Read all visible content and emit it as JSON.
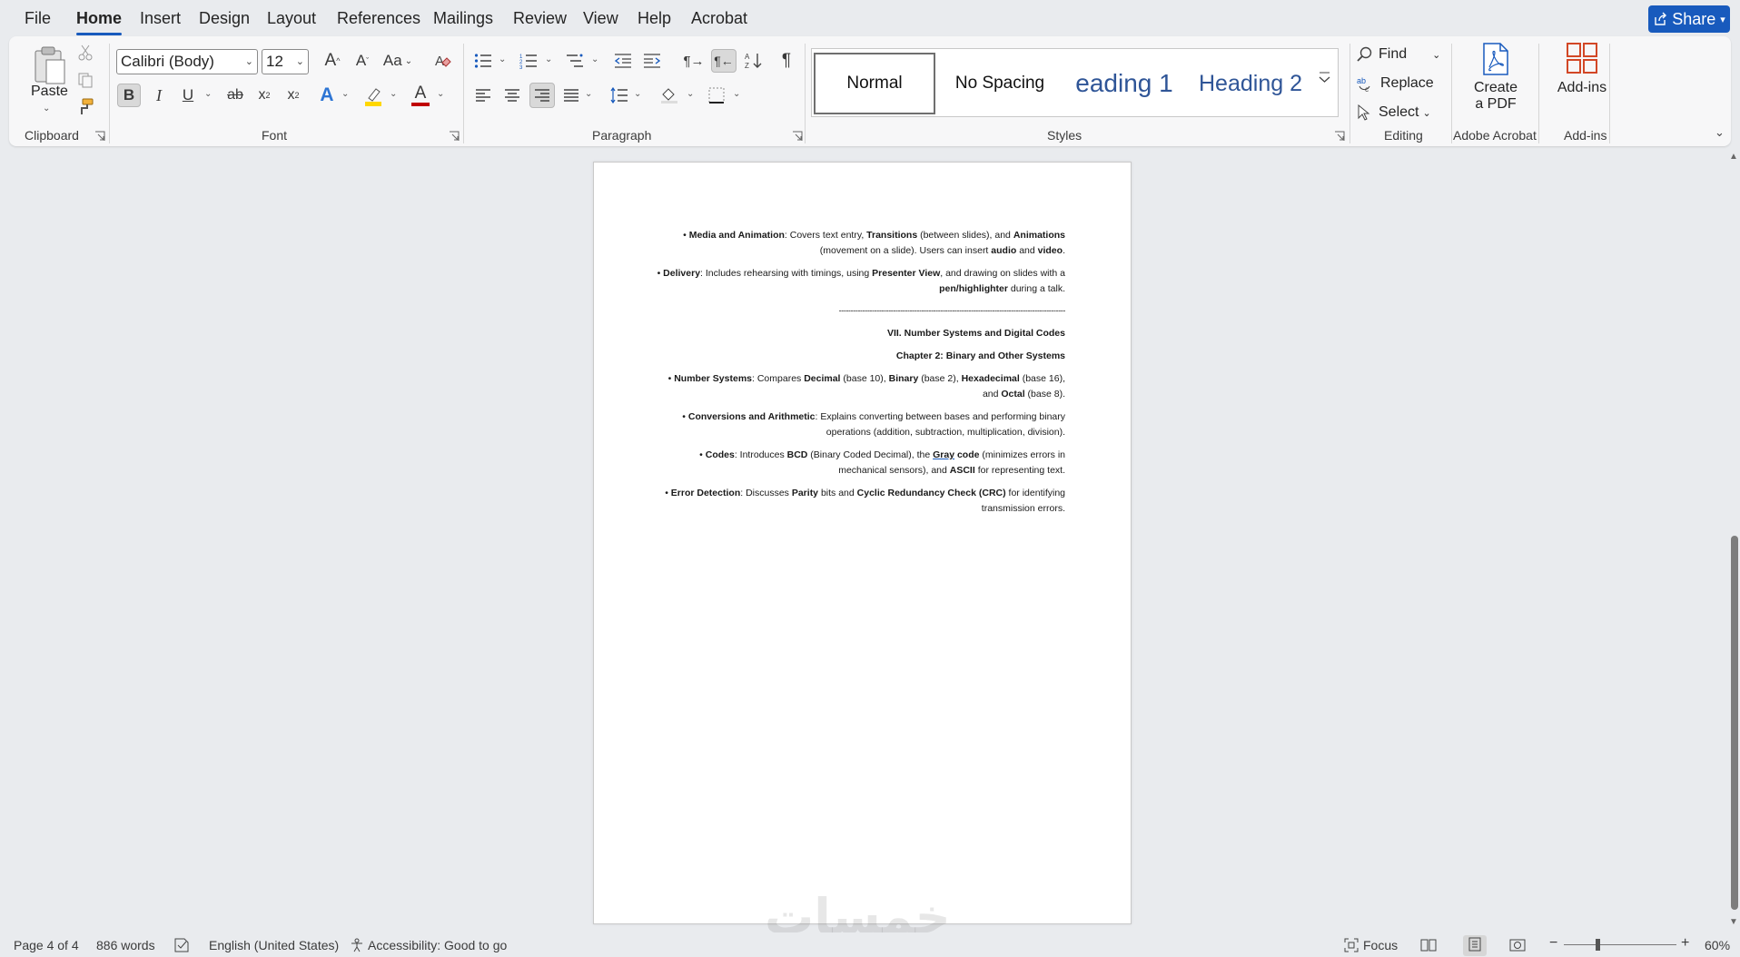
{
  "menu": {
    "tabs": [
      "File",
      "Home",
      "Insert",
      "Design",
      "Layout",
      "References",
      "Mailings",
      "Review",
      "View",
      "Help",
      "Acrobat"
    ],
    "active_tab": "Home",
    "share_label": "Share"
  },
  "ribbon": {
    "clipboard": {
      "paste_label": "Paste",
      "group_label": "Clipboard"
    },
    "font": {
      "font_name": "Calibri (Body)",
      "font_size": "12",
      "group_label": "Font",
      "change_case": "Aa"
    },
    "paragraph": {
      "group_label": "Paragraph"
    },
    "styles": {
      "group_label": "Styles",
      "items": [
        "Normal",
        "No Spacing",
        "eading 1",
        "Heading 2"
      ],
      "selected": "Normal"
    },
    "editing": {
      "find_label": "Find",
      "replace_label": "Replace",
      "select_label": "Select",
      "group_label": "Editing"
    },
    "acrobat": {
      "create_pdf_label_1": "Create",
      "create_pdf_label_2": "a PDF",
      "group_label": "Adobe Acrobat"
    },
    "addins": {
      "label": "Add-ins",
      "group_label": "Add-ins"
    }
  },
  "document": {
    "p1": {
      "bullet": "•",
      "b1": "Media and Animation",
      "t1": ": Covers text entry, ",
      "b2": "Transitions",
      "t2": " (between slides), and ",
      "b3": "Animations",
      "t3": " (movement on a slide). Users can insert ",
      "b4": "audio",
      "t4": " and ",
      "b5": "video",
      "t5": "."
    },
    "p2": {
      "bullet": "•",
      "b1": "Delivery",
      "t1": ": Includes rehearsing with timings, using ",
      "b2": "Presenter View",
      "t2": ", and drawing on slides with a ",
      "b3": "pen/highlighter",
      "t3": " during a talk."
    },
    "divider": "------------------------------------------------------------------------------------------------",
    "heading1": "VII. Number Systems and Digital Codes",
    "heading2": "Chapter 2: Binary and Other Systems",
    "p3": {
      "bullet": "•",
      "b1": "Number Systems",
      "t1": ": Compares ",
      "b2": "Decimal",
      "t2": " (base 10), ",
      "b3": "Binary",
      "t3": " (base 2), ",
      "b4": "Hexadecimal",
      "t4": " (base 16), and ",
      "b5": "Octal",
      "t5": " (base 8)."
    },
    "p4": {
      "bullet": "•",
      "b1": "Conversions and Arithmetic",
      "t1": ": Explains converting between bases and performing binary operations (addition, subtraction, multiplication, division)."
    },
    "p5": {
      "bullet": "•",
      "b1": "Codes",
      "t1": ": Introduces ",
      "b2": "BCD",
      "t2": " (Binary Coded Decimal), the ",
      "b3": "Gray",
      "b3b": " code",
      "t3": " (minimizes errors in mechanical sensors), and ",
      "b4": "ASCII",
      "t4": " for representing text."
    },
    "p6": {
      "bullet": "•",
      "b1": "Error Detection",
      "t1": ": Discusses ",
      "b2": "Parity",
      "t2": " bits and ",
      "b3": "Cyclic Redundancy Check (CRC)",
      "t3": " for identifying transmission errors."
    },
    "watermark": "خمسات"
  },
  "status": {
    "page": "Page 4 of 4",
    "words": "886 words",
    "language": "English (United States)",
    "accessibility": "Accessibility: Good to go",
    "focus": "Focus",
    "zoom": "60%",
    "zoom_level": 0.6
  },
  "colors": {
    "accent": "#185abd",
    "heading_blue": "#2f5597",
    "font_color_red": "#c00000",
    "highlight_yellow": "#ffd700"
  }
}
